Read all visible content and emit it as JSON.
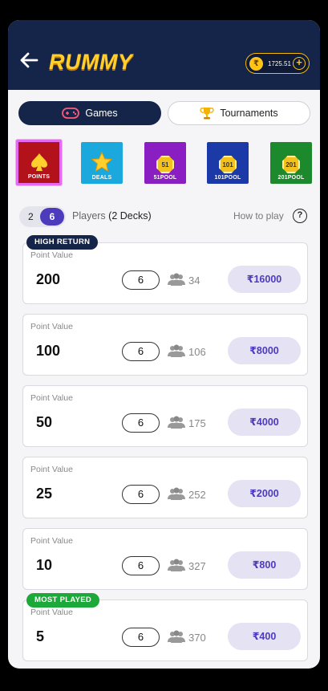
{
  "header": {
    "title": "RUMMY",
    "wallet_symbol": "₹",
    "wallet_amount": "1725.51",
    "add_label": "+"
  },
  "tabs": [
    {
      "label": "Games",
      "active": true,
      "icon": "gamepad-icon"
    },
    {
      "label": "Tournaments",
      "active": false,
      "icon": "trophy-icon"
    }
  ],
  "variants": [
    {
      "label": "POINTS",
      "selected": true,
      "icon": "spade-icon"
    },
    {
      "label": "DEALS",
      "icon": "star-icon"
    },
    {
      "label": "51POOL",
      "coin": "51"
    },
    {
      "label": "101POOL",
      "coin": "101"
    },
    {
      "label": "201POOL",
      "coin": "201"
    }
  ],
  "players": {
    "option_a": "2",
    "option_b": "6",
    "label": "Players",
    "decks": "(2 Decks)",
    "how_to_play": "How to play",
    "help": "?"
  },
  "tables": [
    {
      "badge": "HIGH RETURN",
      "label": "Point Value",
      "value": "200",
      "seats": "6",
      "online": "34",
      "entry": "₹16000"
    },
    {
      "label": "Point Value",
      "value": "100",
      "seats": "6",
      "online": "106",
      "entry": "₹8000"
    },
    {
      "label": "Point Value",
      "value": "50",
      "seats": "6",
      "online": "175",
      "entry": "₹4000"
    },
    {
      "label": "Point Value",
      "value": "25",
      "seats": "6",
      "online": "252",
      "entry": "₹2000"
    },
    {
      "label": "Point Value",
      "value": "10",
      "seats": "6",
      "online": "327",
      "entry": "₹800"
    },
    {
      "badge": "MOST PLAYED",
      "label": "Point Value",
      "value": "5",
      "seats": "6",
      "online": "370",
      "entry": "₹400"
    }
  ],
  "colors": {
    "header": "#15254a",
    "accent": "#4d3bbd",
    "gold": "#ffcf2e",
    "most_played": "#1da83a"
  }
}
